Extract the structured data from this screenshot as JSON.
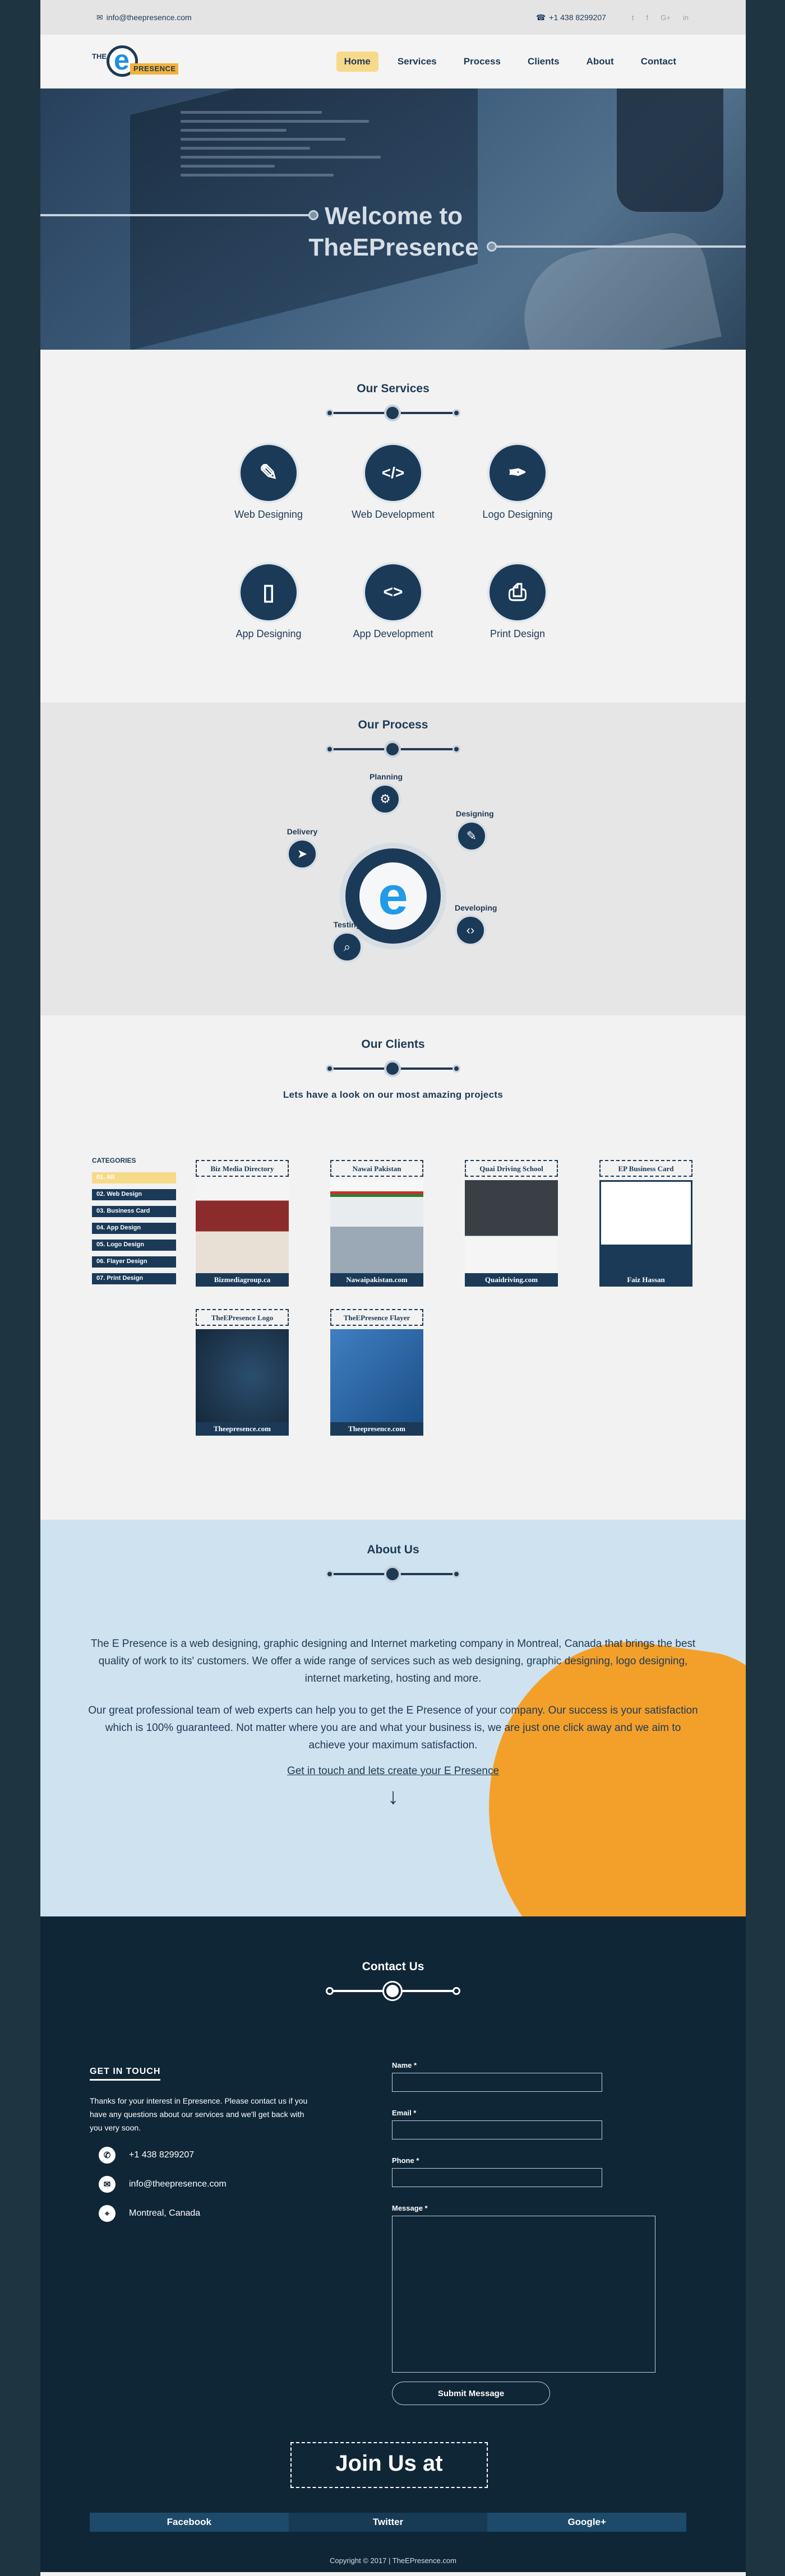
{
  "topbar": {
    "email": "info@theepresence.com",
    "phone": "+1 438 8299207",
    "social": [
      "t",
      "f",
      "G+",
      "in"
    ]
  },
  "logo": {
    "the": "THE",
    "e": "e",
    "word": "PRESENCE"
  },
  "nav": [
    "Home",
    "Services",
    "Process",
    "Clients",
    "About",
    "Contact"
  ],
  "hero": {
    "line1": "Welcome to",
    "line2": "TheEPresence"
  },
  "services": {
    "title": "Our Services",
    "items": [
      {
        "label": "Web Designing",
        "icon": "web-designing-icon",
        "glyph": "✎"
      },
      {
        "label": "Web Development",
        "icon": "code-window-icon",
        "glyph": "</>"
      },
      {
        "label": "Logo Designing",
        "icon": "pen-icon",
        "glyph": "✒"
      },
      {
        "label": "App Designing",
        "icon": "phone-icon",
        "glyph": "▯"
      },
      {
        "label": "App Development",
        "icon": "app-code-icon",
        "glyph": "<>"
      },
      {
        "label": "Print Design",
        "icon": "printer-icon",
        "glyph": "⎙"
      }
    ]
  },
  "process": {
    "title": "Our Process",
    "center": "e",
    "steps": [
      "Planning",
      "Designing",
      "Developing",
      "Testing",
      "Delivery"
    ]
  },
  "clients": {
    "title": "Our Clients",
    "subtitle": "Lets have a look on our most amazing projects",
    "categories_title": "CATEGORIES",
    "categories": [
      "01.   All",
      "02.   Web Design",
      "03.   Business Card",
      "04.   App Design",
      "05.   Logo Design",
      "06.   Flayer Design",
      "07.   Print Design"
    ],
    "cards": [
      {
        "title": "Biz Media Directory",
        "site": "Bizmediagroup.ca"
      },
      {
        "title": "Nawai Pakistan",
        "site": "Nawaipakistan.com"
      },
      {
        "title": "Quai Driving School",
        "site": "Quaidriving.com"
      },
      {
        "title": "EP Business Card",
        "site": "Faiz Hassan"
      },
      {
        "title": "TheEPresence Logo",
        "site": "Theepresence.com"
      },
      {
        "title": "TheEPresence Flayer",
        "site": "Theepresence.com"
      }
    ]
  },
  "about": {
    "title": "About Us",
    "p1": "The E Presence is a web designing, graphic designing and Internet marketing company in Montreal, Canada that brings the best quality of work to its' customers. We offer a wide range of services such as web designing, graphic designing, logo designing, internet marketing, hosting and more.",
    "p2": "Our great professional team of web experts can help you to get the E Presence of your company. Our success is your satisfaction which is 100% guaranteed. Not matter where you are and what your business is, we are just one click away and we aim to achieve your maximum satisfaction.",
    "cta": "Get in touch and lets create your E Presence",
    "arrow": "↓"
  },
  "contact": {
    "title": "Contact Us",
    "git_title": "GET IN TOUCH",
    "git_text": "Thanks for your interest in Epresence. Please contact us if you have any questions about our services and we'll get back with you very soon.",
    "phone": "+1 438 8299207",
    "email": "info@theepresence.com",
    "location": "Montreal, Canada",
    "labels": {
      "name": "Name *",
      "email": "Email *",
      "phone": "Phone *",
      "message": "Message *"
    },
    "submit": "Submit Message",
    "join": "Join Us at",
    "social": [
      "Facebook",
      "Twitter",
      "Google+"
    ],
    "copyright": "Copyright © 2017 | TheEPresence.com"
  }
}
